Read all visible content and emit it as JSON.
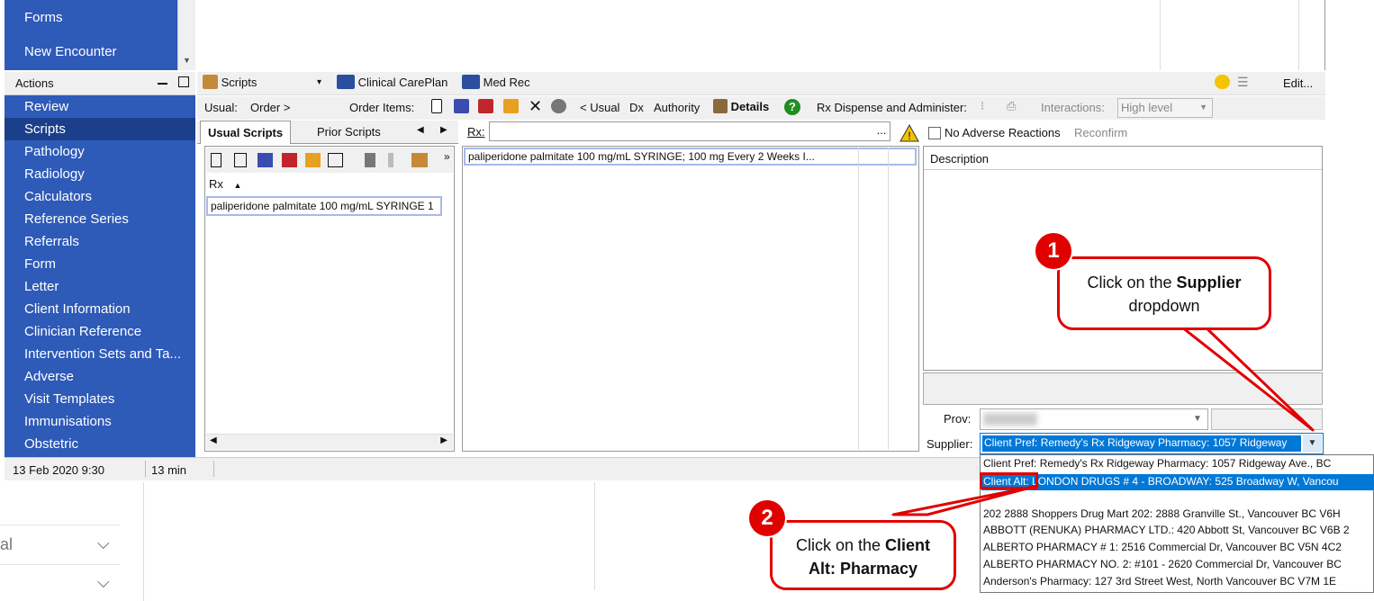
{
  "sidebar_top": {
    "forms": "Forms",
    "new_encounter": "New Encounter"
  },
  "actions": {
    "header": "Actions"
  },
  "sidebar": {
    "items": [
      {
        "label": "Review"
      },
      {
        "label": "Scripts",
        "selected": true
      },
      {
        "label": "Pathology"
      },
      {
        "label": "Radiology"
      },
      {
        "label": "Calculators"
      },
      {
        "label": "Reference Series"
      },
      {
        "label": "Referrals"
      },
      {
        "label": "Form"
      },
      {
        "label": "Letter"
      },
      {
        "label": "Client Information"
      },
      {
        "label": "Clinician Reference"
      },
      {
        "label": "Intervention Sets and Ta..."
      },
      {
        "label": "Adverse"
      },
      {
        "label": "Visit Templates"
      },
      {
        "label": "Immunisations"
      },
      {
        "label": "Obstetric"
      }
    ]
  },
  "status": {
    "date": "13 Feb 2020 9:30",
    "duration": "13 min"
  },
  "toolbar1": {
    "scripts": "Scripts",
    "clinical_careplan": "Clinical CarePlan",
    "med_rec": "Med Rec",
    "edit": "Edit..."
  },
  "toolbar2": {
    "usual": "Usual:",
    "order": "Order >",
    "order_items": "Order Items:",
    "usual_link": "< Usual",
    "dx": "Dx",
    "authority": "Authority",
    "details": "Details",
    "rx_dispense": "Rx Dispense and Administer:",
    "interactions": "Interactions:",
    "interactions_value": "High level"
  },
  "tabs": {
    "usual_scripts": "Usual Scripts",
    "prior_scripts": "Prior Scripts"
  },
  "left_list": {
    "header": "Rx",
    "rows": [
      "paliperidone palmitate 100 mg/mL SYRINGE  1"
    ]
  },
  "rx": {
    "label": "Rx:",
    "dots": "...",
    "no_adverse": "No Adverse Reactions",
    "reconfirm": "Reconfirm"
  },
  "mid_list": {
    "rows": [
      "paliperidone palmitate 100 mg/mL SYRINGE; 100 mg Every 2 Weeks I..."
    ]
  },
  "description": {
    "header": "Description"
  },
  "prov": {
    "label": "Prov:"
  },
  "supplier": {
    "label": "Supplier:",
    "selected": "Client Pref: Remedy's Rx Ridgeway Pharmacy: 1057 Ridgeway",
    "options": [
      "Client Pref: Remedy's Rx Ridgeway Pharmacy: 1057 Ridgeway Ave., BC",
      "Client Alt: LONDON DRUGS # 4 - BROADWAY: 525 Broadway W, Vancou",
      ".",
      "202 2888 Shoppers Drug Mart 202: 2888 Granville St., Vancouver BC V6H",
      "ABBOTT (RENUKA) PHARMACY LTD.: 420 Abbott St, Vancouver BC V6B 2",
      "ALBERTO PHARMACY # 1: 2516 Commercial Dr, Vancouver BC V5N 4C2",
      "ALBERTO PHARMACY NO. 2: #101 - 2620 Commercial Dr, Vancouver BC",
      "Anderson's Pharmacy: 127 3rd Street West, North Vancouver BC V7M 1E"
    ]
  },
  "below": {
    "row1": "al"
  },
  "callouts": {
    "one": {
      "num": "1",
      "line1_pre": "Click on the ",
      "line1_bold": "Supplier",
      "line2": "dropdown"
    },
    "two": {
      "num": "2",
      "line1_pre": "Click on the ",
      "line1_bold": "Client",
      "line2": "Alt: Pharmacy"
    }
  },
  "colors": {
    "sidebar_blue": "#2e5ab8",
    "selection_blue": "#0078d7",
    "callout_red": "#e00000"
  }
}
